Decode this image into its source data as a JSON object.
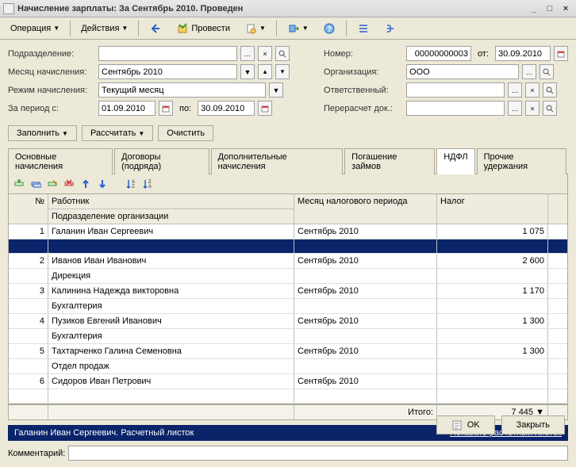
{
  "window": {
    "title": "Начисление зарплаты: За Сентябрь 2010. Проведен"
  },
  "toolbar": {
    "operation": "Операция",
    "actions": "Действия",
    "post": "Провести"
  },
  "form": {
    "dept_label": "Подразделение:",
    "dept_value": "",
    "month_label": "Месяц начисления:",
    "month_value": "Сентябрь 2010",
    "mode_label": "Режим начисления:",
    "mode_value": "Текущий месяц",
    "period_label": "За период с:",
    "period_from": "01.09.2010",
    "period_to_lbl": "по:",
    "period_to": "30.09.2010",
    "number_label": "Номер:",
    "number_value": "00000000003",
    "date_lbl": "от:",
    "date_value": "30.09.2010",
    "org_label": "Организация:",
    "org_value": "ООО",
    "resp_label": "Ответственный:",
    "resp_value": "",
    "recalc_label": "Перерасчет док.:",
    "recalc_value": ""
  },
  "buttons": {
    "fill": "Заполнить",
    "calc": "Рассчитать",
    "clear": "Очистить"
  },
  "tabs": [
    "Основные начисления",
    "Договоры (подряда)",
    "Дополнительные начисления",
    "Погашение займов",
    "НДФЛ",
    "Прочие удержания"
  ],
  "grid": {
    "headers": {
      "n": "№",
      "emp": "Работник",
      "dept": "Подразделение организации",
      "month": "Месяц налогового периода",
      "tax": "Налог"
    },
    "rows": [
      {
        "n": "1",
        "emp": "Галанин Иван Сергеевич",
        "dept": "",
        "month": "Сентябрь 2010",
        "tax": "1 075",
        "selected": true
      },
      {
        "n": "2",
        "emp": "Иванов Иван Иванович",
        "dept": "Дирекция",
        "month": "Сентябрь 2010",
        "tax": "2 600"
      },
      {
        "n": "3",
        "emp": "Калинина Надежда викторовна",
        "dept": "Бухгалтерия",
        "month": "Сентябрь 2010",
        "tax": "1 170"
      },
      {
        "n": "4",
        "emp": "Пузиков Евгений Иванович",
        "dept": "Бухгалтерия",
        "month": "Сентябрь 2010",
        "tax": "1 300"
      },
      {
        "n": "5",
        "emp": "Тахтарченко Галина Семеновна",
        "dept": "Отдел продаж",
        "month": "Сентябрь 2010",
        "tax": "1 300"
      },
      {
        "n": "6",
        "emp": "Сидоров Иван Петрович",
        "dept": "",
        "month": "Сентябрь 2010",
        "tax": ""
      }
    ],
    "total_label": "Итого:",
    "total_value": "7 445"
  },
  "bluebar": {
    "text": "Галанин Иван Сергеевич. Расчетный листок",
    "link": "Показать расчетный листок"
  },
  "comment": {
    "label": "Комментарий:",
    "value": ""
  },
  "footer": {
    "ok": "OK",
    "close": "Закрыть"
  }
}
